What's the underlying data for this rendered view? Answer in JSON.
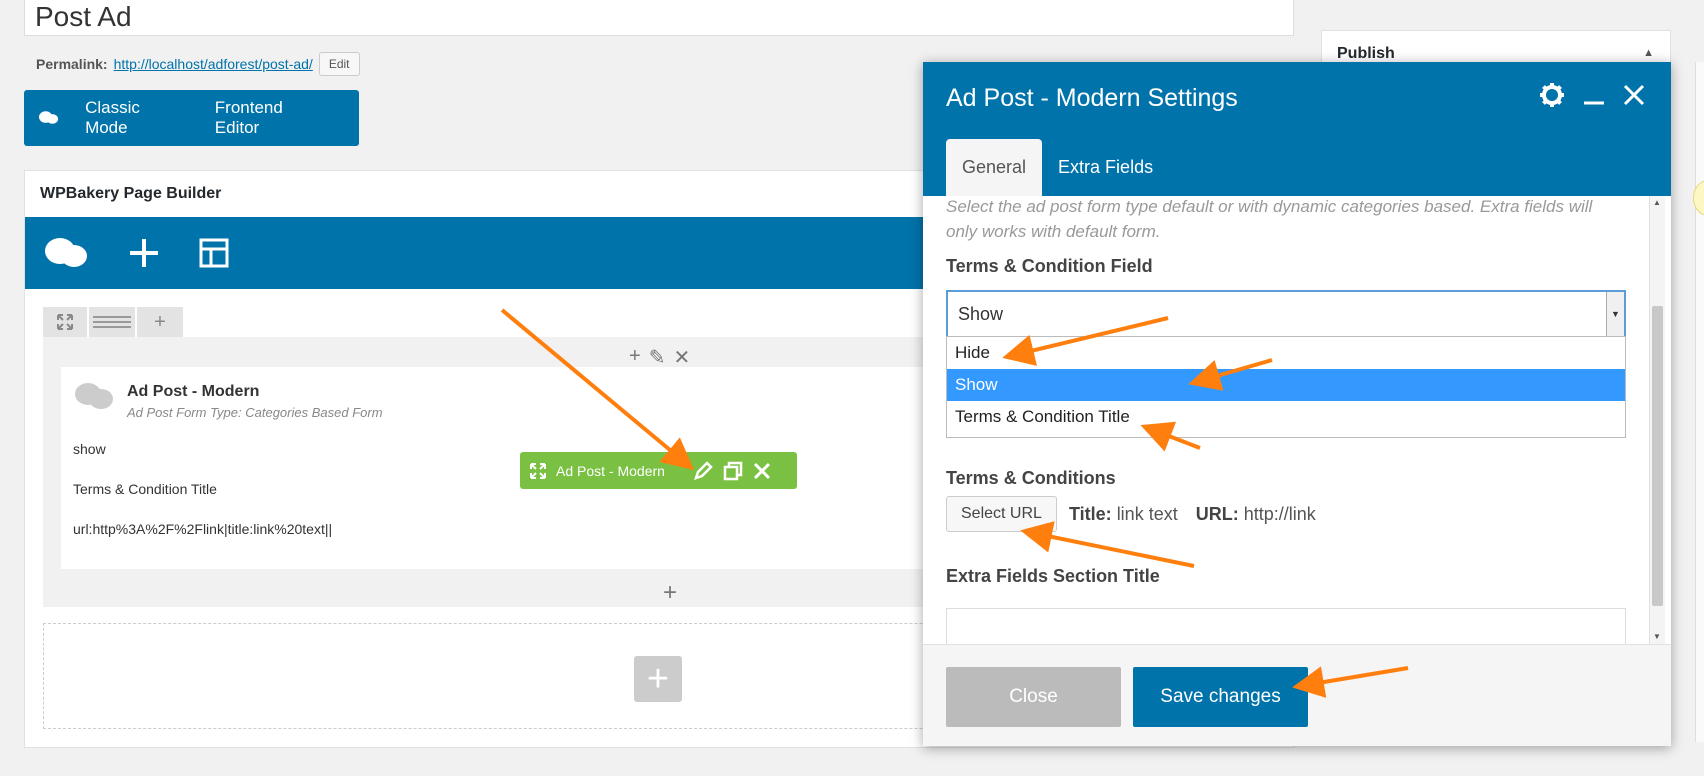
{
  "page": {
    "title": "Post Ad",
    "permalink_label": "Permalink:",
    "permalink_url": "http://localhost/adforest/post-ad/",
    "edit_label": "Edit"
  },
  "mode_bar": {
    "classic": "Classic Mode",
    "frontend": "Frontend Editor"
  },
  "builder": {
    "title": "WPBakery Page Builder",
    "element": {
      "title": "Ad Post - Modern",
      "subtitle": "Ad Post Form Type: Categories Based Form",
      "lines": [
        "show",
        "Terms & Condition Title",
        "url:http%3A%2F%2Flink|title:link%20text||"
      ]
    },
    "hover_bar_label": "Ad Post - Modern"
  },
  "publish": {
    "title": "Publish"
  },
  "modal": {
    "title": "Ad Post - Modern Settings",
    "tabs": [
      {
        "label": "General",
        "active": true
      },
      {
        "label": "Extra Fields",
        "active": false
      }
    ],
    "help_text": "Select the ad post form type default or with dynamic categories based. Extra fields will only works with default form.",
    "terms_field": {
      "label": "Terms & Condition Field",
      "value": "Show",
      "options": [
        "Hide",
        "Show",
        "Terms & Condition Title"
      ],
      "highlighted": "Show"
    },
    "terms_conditions": {
      "label": "Terms & Conditions",
      "button": "Select URL",
      "title_label": "Title:",
      "title_value": "link text",
      "url_label": "URL:",
      "url_value": "http://link"
    },
    "extra_title": {
      "label": "Extra Fields Section Title",
      "value": ""
    },
    "close_label": "Close",
    "save_label": "Save changes"
  },
  "colors": {
    "brand_blue": "#0073aa",
    "highlight_blue": "#3399ff",
    "element_green": "#7ac143",
    "annotation_orange": "#ff7f0e"
  }
}
